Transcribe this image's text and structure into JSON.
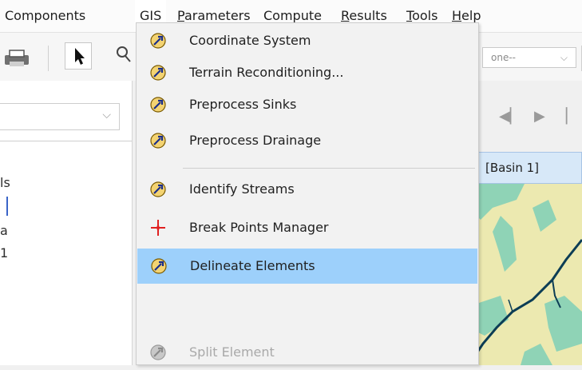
{
  "menubar": {
    "items": [
      {
        "label": "Components",
        "underline": ""
      },
      {
        "label": "GIS",
        "underline": ""
      },
      {
        "label": "Parameters",
        "underline": "P"
      },
      {
        "label": "Compute",
        "underline": ""
      },
      {
        "label": "Results",
        "underline": "R"
      },
      {
        "label": "Tools",
        "underline": "T"
      },
      {
        "label": "Help",
        "underline": "H"
      }
    ]
  },
  "toolbar": {
    "right_combo_value": "one--"
  },
  "left_panel": {
    "fragments": [
      "ls",
      "a",
      "1"
    ]
  },
  "map": {
    "header_title": "[Basin 1]"
  },
  "gis_menu": {
    "items": [
      {
        "label": "Coordinate System",
        "icon": "wrench-gis-icon",
        "state": "normal"
      },
      {
        "label": "Terrain Reconditioning...",
        "icon": "wrench-gis-icon",
        "state": "normal"
      },
      {
        "label": "Preprocess Sinks",
        "icon": "wrench-gis-icon",
        "state": "normal"
      },
      {
        "label": "Preprocess Drainage",
        "icon": "wrench-gis-icon",
        "state": "normal"
      },
      {
        "label": "Identify Streams",
        "icon": "wrench-gis-icon",
        "state": "normal"
      },
      {
        "label": "Break Points Manager",
        "icon": "break-point-icon",
        "state": "normal"
      },
      {
        "label": "Delineate Elements",
        "icon": "wrench-gis-icon",
        "state": "highlighted"
      },
      {
        "label": "Split Element",
        "icon": "wrench-gis-icon",
        "state": "disabled"
      }
    ]
  },
  "colors": {
    "highlight": "#9dd0fb",
    "map_land": "#ece9b0",
    "map_green": "#8fd3b6",
    "stream": "#0c3d55"
  }
}
